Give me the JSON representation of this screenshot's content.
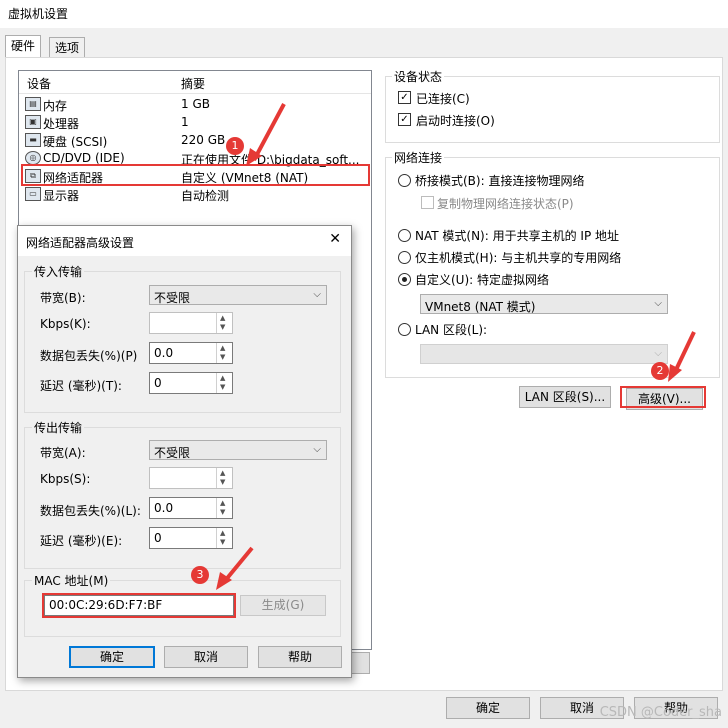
{
  "window": {
    "title": "虚拟机设置",
    "close_glyph": "✕"
  },
  "tabs": [
    {
      "label": "硬件"
    },
    {
      "label": "选项"
    }
  ],
  "devices": {
    "header": {
      "device": "设备",
      "summary": "摘要"
    },
    "rows": [
      {
        "icon": "memory-icon",
        "name": "内存",
        "summary": "1 GB"
      },
      {
        "icon": "cpu-icon",
        "name": "处理器",
        "summary": "1"
      },
      {
        "icon": "disk-icon",
        "name": "硬盘 (SCSI)",
        "summary": "220 GB"
      },
      {
        "icon": "cdrom-icon",
        "name": "CD/DVD (IDE)",
        "summary": "正在使用文件 D:\\bigdata_soft..."
      },
      {
        "icon": "network-icon",
        "name": "网络适配器",
        "summary": "自定义 (VMnet8 (NAT)"
      },
      {
        "icon": "display-icon",
        "name": "显示器",
        "summary": "自动检测"
      }
    ]
  },
  "device_status": {
    "title": "设备状态",
    "connected": {
      "label": "已连接(C)",
      "checked": true
    },
    "connect_on_power": {
      "label": "启动时连接(O)",
      "checked": true
    }
  },
  "network": {
    "title": "网络连接",
    "bridged": "桥接模式(B): 直接连接物理网络",
    "replicate": "复制物理网络连接状态(P)",
    "nat": "NAT 模式(N): 用于共享主机的 IP 地址",
    "host_only": "仅主机模式(H): 与主机共享的专用网络",
    "custom": "自定义(U): 特定虚拟网络",
    "custom_value": "VMnet8 (NAT 模式)",
    "lan": "LAN 区段(L):",
    "lan_value": ""
  },
  "buttons": {
    "lan_segments": "LAN 区段(S)...",
    "advanced": "高级(V)...",
    "ok": "确定",
    "cancel": "取消",
    "help": "帮助"
  },
  "dialog": {
    "title": "网络适配器高级设置",
    "incoming": {
      "title": "传入传输",
      "bandwidth_label": "带宽(B):",
      "bandwidth_value": "不受限",
      "kbps_label": "Kbps(K):",
      "kbps_value": "",
      "loss_label": "数据包丢失(%)(P)",
      "loss_value": "0.0",
      "latency_label": "延迟 (毫秒)(T):",
      "latency_value": "0"
    },
    "outgoing": {
      "title": "传出传输",
      "bandwidth_label": "带宽(A):",
      "bandwidth_value": "不受限",
      "kbps_label": "Kbps(S):",
      "kbps_value": "",
      "loss_label": "数据包丢失(%)(L):",
      "loss_value": "0.0",
      "latency_label": "延迟 (毫秒)(E):",
      "latency_value": "0"
    },
    "mac": {
      "title": "MAC 地址(M)",
      "value": "00:0C:29:6D:F7:BF",
      "generate": "生成(G)"
    },
    "ok": "确定",
    "cancel": "取消",
    "help": "帮助"
  },
  "annotations": {
    "one": "1",
    "two": "2",
    "three": "3",
    "color": "#e53935"
  },
  "watermark": "CSDN @Coder_sha"
}
